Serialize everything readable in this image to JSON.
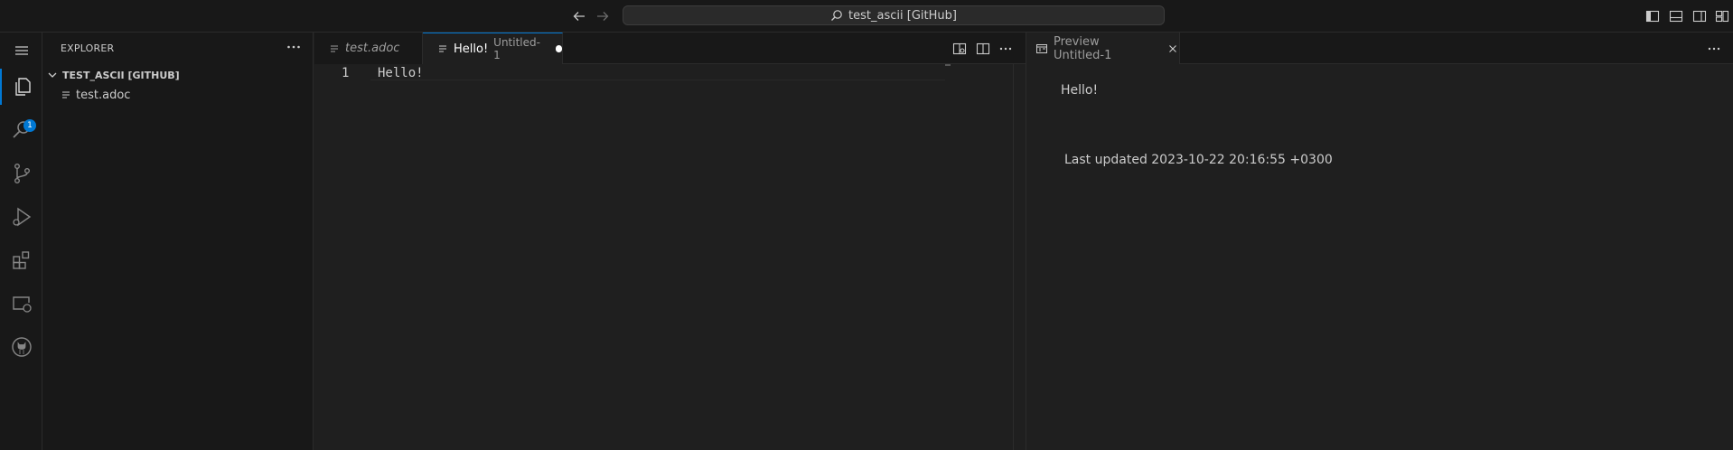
{
  "titlebar": {
    "search_text": "test_ascii [GitHub]"
  },
  "activitybar": {
    "explorer_badge": "1"
  },
  "sidebar": {
    "title": "EXPLORER",
    "folder": "TEST_ASCII [GITHUB]",
    "files": [
      {
        "name": "test.adoc"
      }
    ]
  },
  "editor1": {
    "tabs": [
      {
        "label": "test.adoc"
      },
      {
        "label": "Hello!",
        "sublabel": "Untitled-1"
      }
    ],
    "lines": [
      {
        "number": "1",
        "text": "Hello!"
      }
    ]
  },
  "editor2": {
    "tabs": [
      {
        "label": "Preview Untitled-1"
      }
    ],
    "preview": {
      "heading": "Hello!",
      "last_updated": "Last updated 2023-10-22 20:16:55 +0300"
    }
  },
  "colors": {
    "accent": "#0078d4",
    "background": "#1f1f1f",
    "chrome": "#181818"
  }
}
